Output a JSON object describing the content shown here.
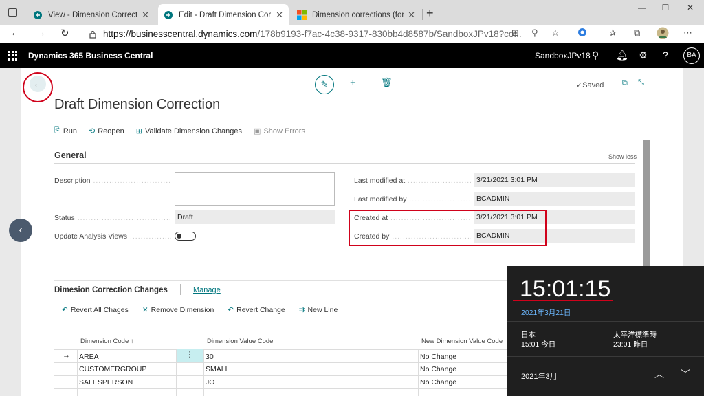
{
  "browser": {
    "tabs": [
      {
        "title": "View - Dimension Corrections - D",
        "active": false
      },
      {
        "title": "Edit - Draft Dimension Correctio",
        "active": true
      },
      {
        "title": "Dimension corrections (for G/L E",
        "active": false
      }
    ],
    "new_tab": "+",
    "url_host": "https://businesscentral.dynamics.com",
    "url_rest": "/178b9193-f7ac-4c38-9317-830bb4d8587b/SandboxJPv18?co..."
  },
  "header": {
    "product": "Dynamics 365 Business Central",
    "environment": "SandboxJPv18",
    "avatar_initials": "BA"
  },
  "page": {
    "title": "Draft Dimension Correction",
    "saved_label": "Saved",
    "actions": [
      "Run",
      "Reopen",
      "Validate Dimension Changes",
      "Show Errors"
    ],
    "general": {
      "heading": "General",
      "show_less": "Show less",
      "description_label": "Description",
      "description_value": "",
      "status_label": "Status",
      "status_value": "Draft",
      "update_analysis_label": "Update Analysis Views",
      "last_modified_at_label": "Last modified at",
      "last_modified_at_value": "3/21/2021 3:01 PM",
      "last_modified_by_label": "Last modified by",
      "last_modified_by_value": "BCADMIN",
      "created_at_label": "Created at",
      "created_at_value": "3/21/2021 3:01 PM",
      "created_by_label": "Created by",
      "created_by_value": "BCADMIN"
    },
    "changes": {
      "heading": "Dimesion Correction Changes",
      "manage": "Manage",
      "actions": [
        "Revert All Chages",
        "Remove Dimension",
        "Revert Change",
        "New Line"
      ],
      "columns": [
        "Dimension Code ↑",
        "Dimension Value Code",
        "New Dimension Value Code"
      ],
      "rows": [
        {
          "code": "AREA",
          "value": "30",
          "new_value": "No Change"
        },
        {
          "code": "CUSTOMERGROUP",
          "value": "SMALL",
          "new_value": "No Change"
        },
        {
          "code": "SALESPERSON",
          "value": "JO",
          "new_value": "No Change"
        }
      ]
    }
  },
  "clock": {
    "time": "15:01:15",
    "date": "2021年3月21日",
    "zone1_name": "日本",
    "zone1_time": "15:01 今日",
    "zone2_name": "太平洋標準時",
    "zone2_time": "23:01 昨日",
    "month": "2021年3月"
  }
}
